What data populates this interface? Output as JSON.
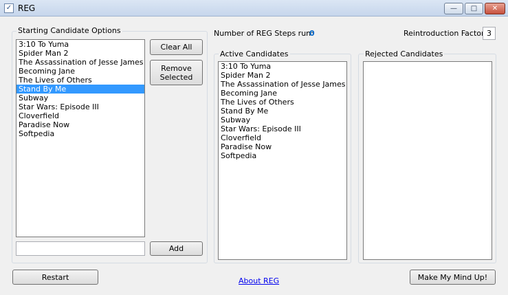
{
  "window": {
    "title": "REG",
    "app_icon_glyph": "✓",
    "minimize_glyph": "—",
    "maximize_glyph": "□",
    "close_glyph": "✕"
  },
  "starting": {
    "title": "Starting Candidate Options",
    "items": [
      "3:10 To Yuma",
      "Spider Man 2",
      "The Assassination of Jesse James",
      "Becoming Jane",
      "The Lives of Others",
      "Stand By Me",
      "Subway",
      "Star Wars: Episode III",
      "Cloverfield",
      "Paradise Now",
      "Softpedia"
    ],
    "selected_index": 5,
    "add_input_value": "",
    "clear_all_label": "Clear All",
    "remove_selected_label": "Remove Selected",
    "add_label": "Add"
  },
  "status": {
    "steps_label": "Number of REG Steps run:",
    "steps_value": "0",
    "reintro_label": "Reintroduction Factor:",
    "reintro_value": "3"
  },
  "active": {
    "title": "Active Candidates",
    "items": [
      "3:10 To Yuma",
      "Spider Man 2",
      "The Assassination of Jesse James",
      "Becoming Jane",
      "The Lives of Others",
      "Stand By Me",
      "Subway",
      "Star Wars: Episode III",
      "Cloverfield",
      "Paradise Now",
      "Softpedia"
    ]
  },
  "rejected": {
    "title": "Rejected Candidates",
    "items": []
  },
  "footer": {
    "restart_label": "Restart",
    "about_link": "About REG",
    "make_mind_label": "Make My Mind Up!"
  }
}
